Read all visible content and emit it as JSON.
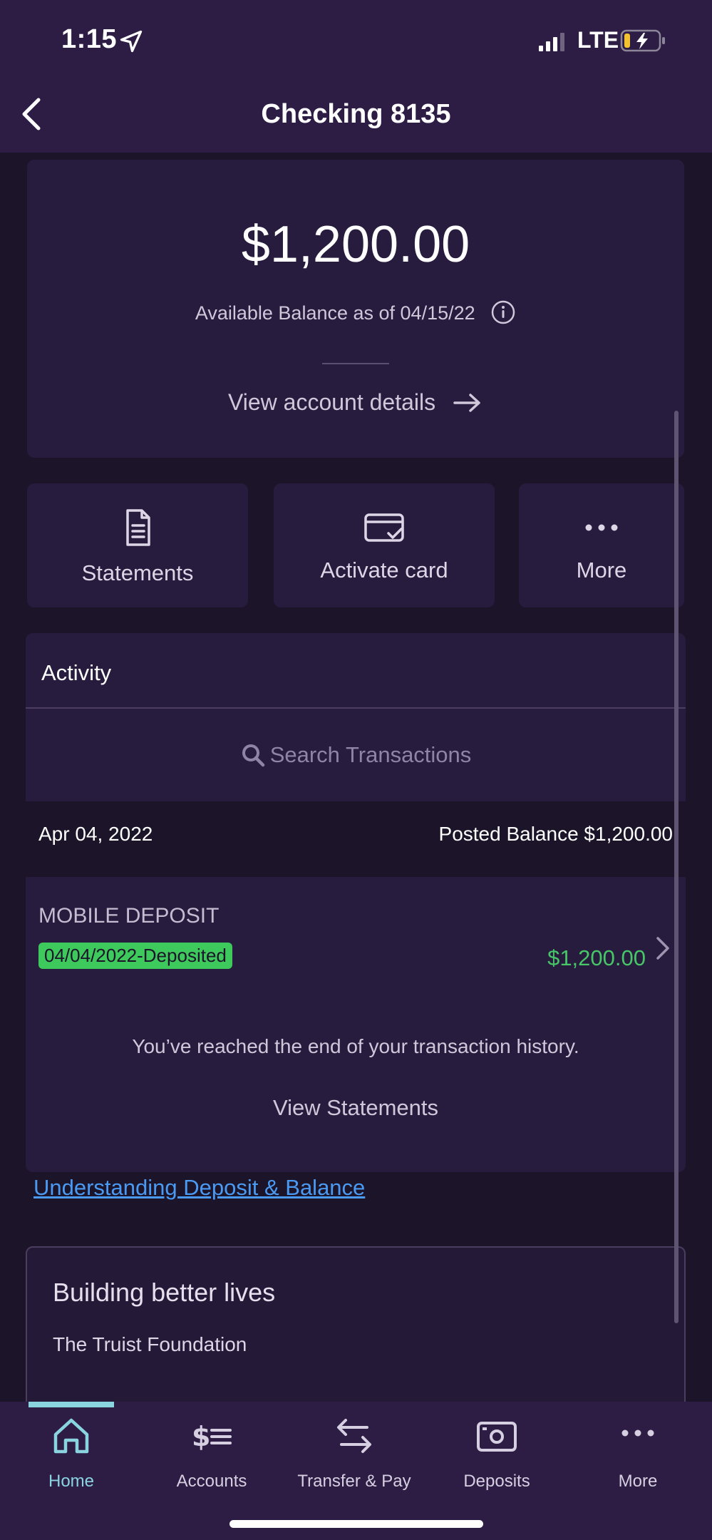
{
  "status_bar": {
    "time": "1:15",
    "network": "LTE"
  },
  "header": {
    "title": "Checking 8135"
  },
  "balance": {
    "amount": "$1,200.00",
    "label": "Available Balance as of 04/15/22",
    "details_link": "View account details"
  },
  "quick_actions": [
    {
      "label": "Statements",
      "icon": "document-icon"
    },
    {
      "label": "Activate card",
      "icon": "card-check-icon"
    },
    {
      "label": "More",
      "icon": "ellipsis-icon"
    }
  ],
  "activity": {
    "title": "Activity",
    "search_placeholder": "Search Transactions",
    "date": "Apr 04, 2022",
    "posted_balance": "Posted Balance $1,200.00",
    "transactions": [
      {
        "name": "MOBILE DEPOSIT",
        "status": "04/04/2022-Deposited",
        "amount": "$1,200.00"
      }
    ],
    "end_message": "You’ve reached the end of your transaction history.",
    "view_statements": "View Statements"
  },
  "help_link": "Understanding Deposit & Balance",
  "promo": {
    "title": "Building better lives",
    "subtitle": "The Truist Foundation"
  },
  "tabs": [
    {
      "label": "Home",
      "icon": "home-icon",
      "active": true
    },
    {
      "label": "Accounts",
      "icon": "accounts-icon",
      "active": false
    },
    {
      "label": "Transfer & Pay",
      "icon": "transfer-icon",
      "active": false
    },
    {
      "label": "Deposits",
      "icon": "camera-icon",
      "active": false
    },
    {
      "label": "More",
      "icon": "ellipsis-icon",
      "active": false
    }
  ],
  "colors": {
    "background": "#1c1429",
    "header": "#2d1d45",
    "card": "#281c3e",
    "accent": "#8ad4e0",
    "positive": "#46c667",
    "link": "#4a9af3"
  }
}
